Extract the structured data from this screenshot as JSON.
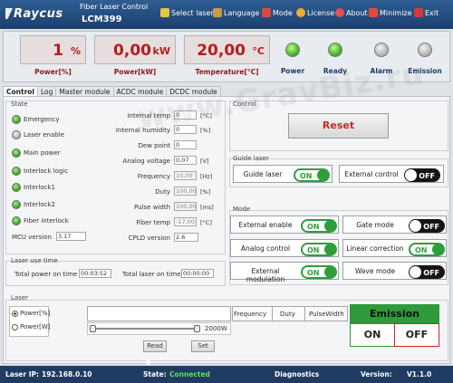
{
  "titlebar": {
    "logo": "Raycus",
    "app_title": "Fiber Laser Control",
    "model": "LCM399",
    "menu": [
      {
        "label": "Select laser",
        "icon": "select-laser-icon",
        "color": "#e8c640"
      },
      {
        "label": "Language",
        "icon": "language-icon",
        "color": "#c99b4b"
      },
      {
        "label": "Mode",
        "icon": "mode-icon",
        "color": "#d84b43"
      },
      {
        "label": "License",
        "icon": "license-icon",
        "color": "#f0a830"
      },
      {
        "label": "About",
        "icon": "about-icon",
        "color": "#e35252"
      },
      {
        "label": "Minimize",
        "icon": "minimize-icon",
        "color": "#e04c3c"
      },
      {
        "label": "Exit",
        "icon": "exit-icon",
        "color": "#d13b3b"
      }
    ]
  },
  "readouts": {
    "power_pct": {
      "value": "1",
      "unit": "%",
      "label": "Power[%]"
    },
    "power_kw": {
      "value": "0,00",
      "unit": "kW",
      "label": "Power[kW]"
    },
    "temperature": {
      "value": "20,00",
      "unit": "°C",
      "label": "Temperature[°C]"
    }
  },
  "indicators": [
    {
      "label": "Power",
      "state": "green"
    },
    {
      "label": "Ready",
      "state": "green"
    },
    {
      "label": "Alarm",
      "state": "gray"
    },
    {
      "label": "Emission",
      "state": "gray"
    }
  ],
  "tabs": [
    "Control",
    "Log",
    "Master module",
    "ACDC module",
    "DCDC module"
  ],
  "watermark": "www.GravBiz.ru",
  "state": {
    "title": "State",
    "items": [
      {
        "label": "Emergency",
        "state": "green"
      },
      {
        "label": "Laser enable",
        "state": "gray"
      },
      {
        "label": "Main power",
        "state": "green"
      },
      {
        "label": "Interlock logic",
        "state": "green"
      },
      {
        "label": "Interlock1",
        "state": "green"
      },
      {
        "label": "Interlock2",
        "state": "green"
      },
      {
        "label": "Fiber interlock",
        "state": "green"
      }
    ],
    "params": [
      {
        "label": "Internal temp",
        "value": "0",
        "unit": "[°C]",
        "disabled": false
      },
      {
        "label": "Internal humidity",
        "value": "0",
        "unit": "[%]",
        "disabled": false
      },
      {
        "label": "Dew point",
        "value": "0",
        "unit": "",
        "disabled": false
      },
      {
        "label": "Analog voltage",
        "value": "0,07",
        "unit": "[V]",
        "disabled": false
      },
      {
        "label": "Frequency",
        "value": "10,00",
        "unit": "[Hz]",
        "disabled": true
      },
      {
        "label": "Duty",
        "value": "100,00",
        "unit": "[%]",
        "disabled": true
      },
      {
        "label": "Pulse width",
        "value": "100,00",
        "unit": "[ms]",
        "disabled": true
      },
      {
        "label": "Fiber temp",
        "value": "-17,00",
        "unit": "[°C]",
        "disabled": true
      }
    ],
    "mcu_label": "MCU version",
    "mcu_value": "3.17",
    "cpld_label": "CPLD version",
    "cpld_value": "2.6"
  },
  "laser_use_time": {
    "title": "Laser use time",
    "total_power_label": "Total power on time",
    "total_power_value": "00:03:52",
    "total_laser_label": "Total laser on time",
    "total_laser_value": "00:00:00"
  },
  "control": {
    "title": "Control",
    "reset_label": "Reset",
    "reset_color": "#c62828"
  },
  "guide_laser": {
    "title": "Guide laser",
    "guide_label": "Guide laser",
    "guide_state": "ON",
    "external_label": "External control",
    "external_state": "OFF"
  },
  "mode": {
    "title": "Mode",
    "items": [
      {
        "label": "External enable",
        "state": "ON"
      },
      {
        "label": "Gate mode",
        "state": "OFF"
      },
      {
        "label": "Analog control",
        "state": "ON"
      },
      {
        "label": "Linear correction",
        "state": "ON"
      },
      {
        "label": "External modulation",
        "state": "ON"
      },
      {
        "label": "Wave mode",
        "state": "OFF"
      }
    ]
  },
  "laser": {
    "title": "Laser",
    "radio_pct": "Power[%]",
    "radio_w": "Power[W]",
    "columns": [
      "Frequency",
      "Duty",
      "PulseWidth"
    ],
    "slider_max": "2000W",
    "read_label": "Read",
    "set_label": "Set"
  },
  "emission": {
    "title": "Emission",
    "on_label": "ON",
    "off_label": "OFF",
    "accent": "#2e9a3a"
  },
  "statusbar": {
    "ip_label": "Laser IP:",
    "ip_value": "192.168.0.10",
    "state_label": "State:",
    "state_value": "Connected",
    "state_color": "#5ee05e",
    "diagnostics": "Diagnostics",
    "version_label": "Version:",
    "version_value": "V1.1.0"
  }
}
